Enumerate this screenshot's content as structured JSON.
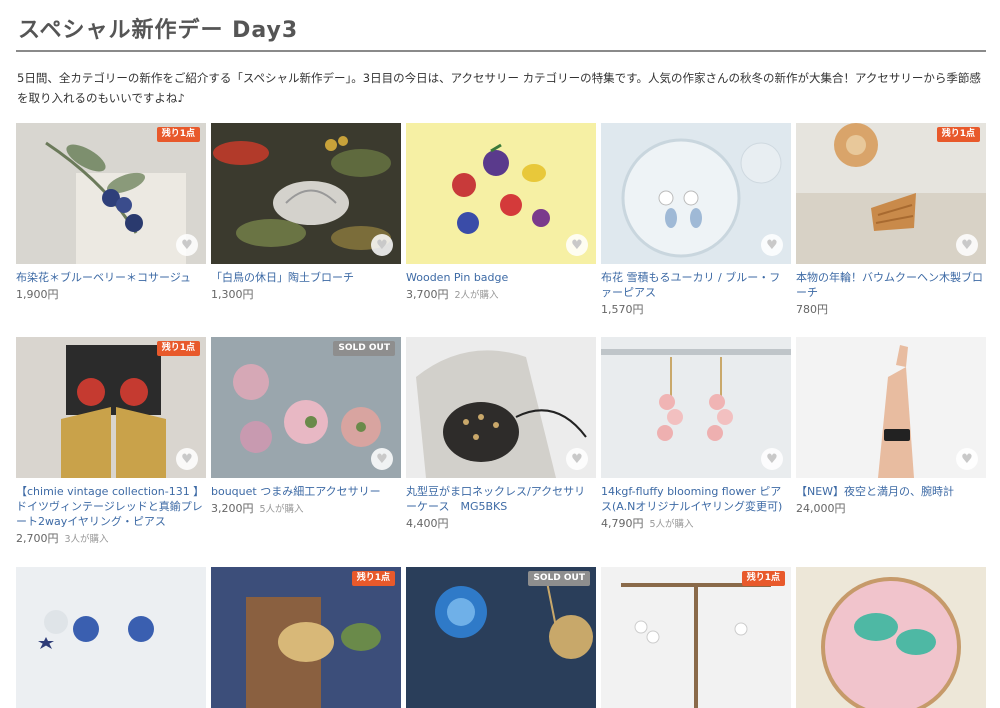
{
  "page": {
    "title": "スペシャル新作デー Day3",
    "intro": "5日間、全カテゴリーの新作をご紹介する「スペシャル新作デー」。3日目の今日は、アクセサリー カテゴリーの特集です。人気の作家さんの秋冬の新作が大集合！アクセサリーから季節感を取り入れるのもいいですよね♪"
  },
  "badges": {
    "last_one": "残り1点",
    "sold_out": "SOLD OUT"
  },
  "colors": {
    "link": "#3d6aa5",
    "badge_last": "#e8592b",
    "badge_sold": "#8e8e8e"
  },
  "items": [
    {
      "title": "布染花＊ブルーベリー＊コサージュ",
      "price": "1,900円",
      "favs": "",
      "badge": "残り1点"
    },
    {
      "title": "「白鳥の休日」陶土ブローチ",
      "price": "1,300円",
      "favs": "",
      "badge": ""
    },
    {
      "title": "Wooden Pin badge",
      "price": "3,700円",
      "favs": "2人が購入",
      "badge": ""
    },
    {
      "title": "布花 雪積もるユーカリ / ブルー・ファーピアス",
      "price": "1,570円",
      "favs": "",
      "badge": ""
    },
    {
      "title": "本物の年輪！バウムクーヘン木製ブローチ",
      "price": "780円",
      "favs": "",
      "badge": "残り1点"
    },
    {
      "title": "【chimie vintage collection-131 】ドイツヴィンテージレッドと真鍮プレート2wayイヤリング・ピアス",
      "price": "2,700円",
      "favs": "3人が購入",
      "badge": "残り1点"
    },
    {
      "title": "bouquet つまみ細工アクセサリー",
      "price": "3,200円",
      "favs": "5人が購入",
      "badge": "SOLD OUT"
    },
    {
      "title": "丸型豆がま口ネックレス/アクセサリーケース　MG5BKS",
      "price": "4,400円",
      "favs": "",
      "badge": ""
    },
    {
      "title": "14kgf-fluffy blooming flower ピアス(A.Nオリジナルイヤリング変更可)",
      "price": "4,790円",
      "favs": "5人が購入",
      "badge": ""
    },
    {
      "title": "【NEW】夜空と満月の、腕時計",
      "price": "24,000円",
      "favs": "",
      "badge": ""
    },
    {
      "title": "",
      "price": "",
      "favs": "",
      "badge": ""
    },
    {
      "title": "",
      "price": "",
      "favs": "",
      "badge": "残り1点"
    },
    {
      "title": "",
      "price": "",
      "favs": "",
      "badge": "SOLD OUT"
    },
    {
      "title": "",
      "price": "",
      "favs": "",
      "badge": "残り1点"
    },
    {
      "title": "",
      "price": "",
      "favs": "",
      "badge": ""
    }
  ]
}
